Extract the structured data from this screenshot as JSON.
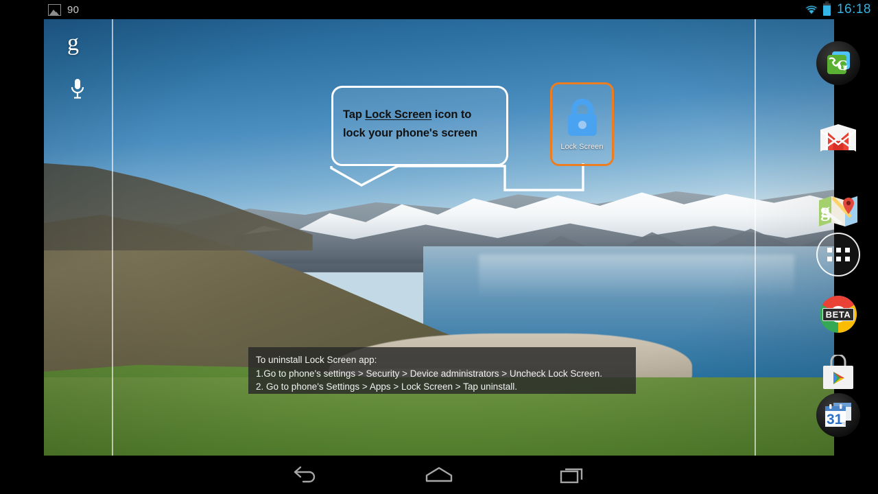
{
  "statusbar": {
    "photo_icon": "photo-icon",
    "notification_count": "90",
    "wifi_icon": "wifi-icon",
    "battery_icon": "battery-icon",
    "clock": "16:18"
  },
  "homescreen": {
    "google_logo": "g",
    "search_icon": "google-g-icon",
    "mic_icon": "microphone-icon",
    "wallpaper_description": "lake and snowy mountain landscape"
  },
  "tooltip": {
    "line1_prefix": "Tap ",
    "highlight": "Lock Screen",
    "line1_suffix": " icon to",
    "line2": "lock your phone's screen",
    "border_color": "#ffffff"
  },
  "lock_tile": {
    "label": "Lock Screen",
    "icon": "padlock-icon",
    "highlight_color": "#ed7d1f",
    "lock_color": "#4aa3f0"
  },
  "infobox": {
    "title": "To uninstall Lock Screen app:",
    "step1": "1.Go to phone's settings > Security > Device administrators > Uncheck Lock Screen.",
    "step2": "2. Go to phone's Settings > Apps > Lock Screen > Tap uninstall."
  },
  "dock": {
    "items": [
      {
        "name": "google-voice",
        "label": "Google Voice",
        "icon": "google-voice-icon"
      },
      {
        "name": "gmail",
        "label": "Gmail",
        "icon": "gmail-icon"
      },
      {
        "name": "maps",
        "label": "Maps",
        "icon": "maps-icon"
      },
      {
        "name": "app-drawer",
        "label": "Apps",
        "icon": "app-drawer-icon"
      },
      {
        "name": "chrome-beta",
        "label": "Chrome Beta",
        "icon": "chrome-icon",
        "badge": "BETA"
      },
      {
        "name": "play-store",
        "label": "Play Store",
        "icon": "play-store-icon"
      },
      {
        "name": "calendar",
        "label": "Calendar",
        "icon": "calendar-icon",
        "day": "31"
      }
    ]
  },
  "navbar": {
    "back": "back-icon",
    "home": "home-icon",
    "recents": "recents-icon"
  }
}
